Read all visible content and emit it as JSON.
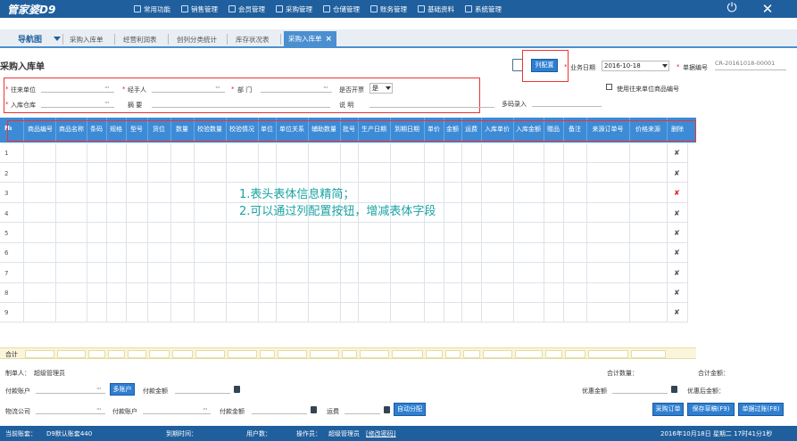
{
  "app": {
    "logo": "管家婆D9"
  },
  "top_menu": [
    "常用功能",
    "销售管理",
    "会员管理",
    "采购管理",
    "仓储管理",
    "账务管理",
    "基础资料",
    "系统管理"
  ],
  "tabs": {
    "nav_label": "导航图",
    "items": [
      "采购入库单",
      "经营利润表",
      "创列分类统计",
      "库存状况表",
      "采购入库单"
    ],
    "close": "×"
  },
  "page": {
    "title": "采购入库单"
  },
  "header": {
    "col_config_button": "列配置",
    "biz_date_label": "业务日期",
    "biz_date_value": "2016-10-18",
    "doc_no_label": "单据编号",
    "doc_no_value": "CR-20161018-00001",
    "vendor_label": "往来单位",
    "handler_label": "经手人",
    "dept_label": "部 门",
    "invoice_label": "是否开票",
    "invoice_value": "是",
    "warehouse_label": "入库仓库",
    "summary_label": "摘 要",
    "note_label": "说 明",
    "barcode_label": "多码录入",
    "use_vendor_code_label": "使用往来单位商品编号",
    "ellipsis": "···"
  },
  "grid": {
    "columns": [
      "商品编号",
      "商品名称",
      "条码",
      "规格",
      "型号",
      "货位",
      "数量",
      "校验数量",
      "校验情况",
      "单位",
      "单位关系",
      "辅助数量",
      "批号",
      "生产日期",
      "到期日期",
      "单价",
      "金额",
      "运费",
      "入库单价",
      "入库金额",
      "赠品",
      "备注",
      "来源订单号",
      "价格来源",
      "删除"
    ],
    "row_numbers": [
      "1",
      "2",
      "3",
      "4",
      "5",
      "6",
      "7",
      "8",
      "9"
    ],
    "delete_icon": "✘",
    "sum_label": "合计"
  },
  "annotation": {
    "line1": "1.表头表体信息精简；",
    "line2": "2.可以通过列配置按钮，增减表体字段"
  },
  "footer": {
    "maker_label": "制单人：",
    "maker_value": "超级管理员",
    "pay_account_label": "付款账户",
    "multi_account_button": "多账户",
    "pay_amount_label": "付款金额",
    "total_qty_label": "合计数量：",
    "total_amount_label": "合计金额：",
    "discount_label": "优惠金额",
    "after_discount_label": "优惠后金额：",
    "logistics_label": "物流公司",
    "pay_account2_label": "付款账户",
    "pay_amount2_label": "付款金额",
    "freight_label": "运费",
    "auto_allocate_button": "自动分配",
    "purchase_order_button": "采购订单",
    "save_draft_button": "保存草稿(F9)",
    "post_button": "单据过账(F8)"
  },
  "status": {
    "account_label": "当前账套：",
    "account_value": "D9默认账套440",
    "expire_label": "到期时间：",
    "users_label": "用户数：",
    "operator_label": "操作员：",
    "operator_value": "超级管理员",
    "change_pwd": "[修改密码]",
    "datetime": "2016年10月18日 星期二 17时41分1秒"
  }
}
